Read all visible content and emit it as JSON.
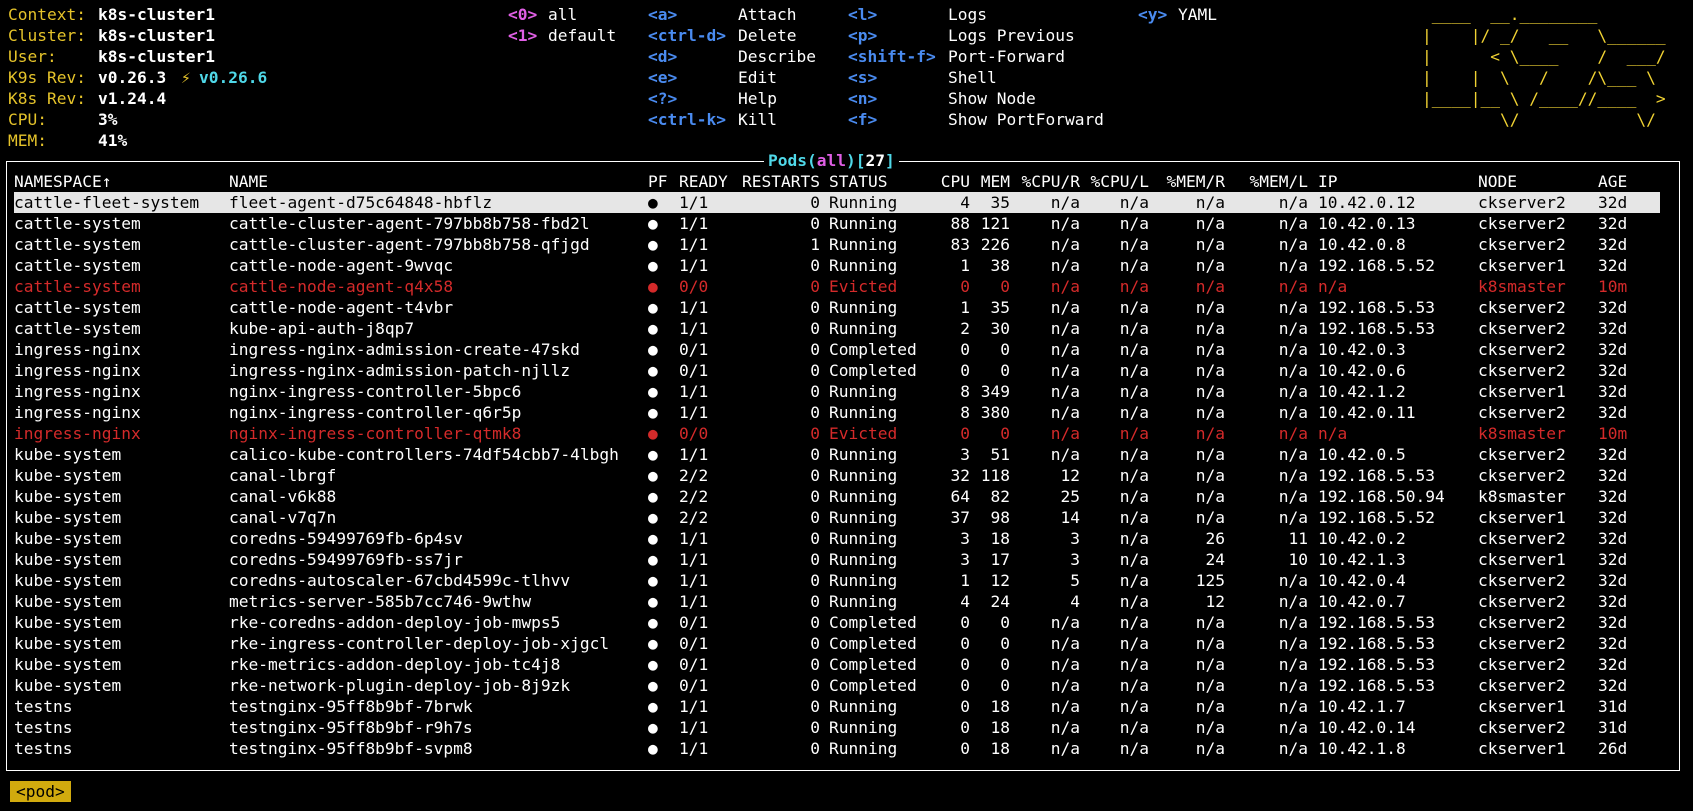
{
  "info": [
    {
      "label": "Context:",
      "value": "k8s-cluster1"
    },
    {
      "label": "Cluster:",
      "value": "k8s-cluster1"
    },
    {
      "label": "User:",
      "value": "k8s-cluster1"
    },
    {
      "label": "K9s Rev:",
      "value": "v0.26.3",
      "extra_sym": "⚡",
      "extra": "v0.26.6"
    },
    {
      "label": "K8s Rev:",
      "value": "v1.24.4"
    },
    {
      "label": "CPU:",
      "value": "3%"
    },
    {
      "label": "MEM:",
      "value": "41%"
    }
  ],
  "namespaces": [
    {
      "key": "<0>",
      "name": "all"
    },
    {
      "key": "<1>",
      "name": "default"
    }
  ],
  "shortcuts_col1": [
    {
      "key": "<a>",
      "desc": "Attach"
    },
    {
      "key": "<ctrl-d>",
      "desc": "Delete"
    },
    {
      "key": "<d>",
      "desc": "Describe"
    },
    {
      "key": "<e>",
      "desc": "Edit"
    },
    {
      "key": "<?>",
      "desc": "Help"
    },
    {
      "key": "<ctrl-k>",
      "desc": "Kill"
    }
  ],
  "shortcuts_col2": [
    {
      "key": "<l>",
      "desc": "Logs"
    },
    {
      "key": "<p>",
      "desc": "Logs Previous"
    },
    {
      "key": "<shift-f>",
      "desc": "Port-Forward"
    },
    {
      "key": "<s>",
      "desc": "Shell"
    },
    {
      "key": "<n>",
      "desc": "Show Node"
    },
    {
      "key": "<f>",
      "desc": "Show PortForward"
    }
  ],
  "shortcuts_col3": [
    {
      "key": "<y>",
      "desc": "YAML"
    }
  ],
  "logo": [
    " ____  __.________        ",
    "|    |/ _/   __   \\______ ",
    "|      < \\____    /  ___/ ",
    "|    |  \\   /    /\\___ \\  ",
    "|____|__ \\ /____//____  > ",
    "        \\/            \\/  "
  ],
  "table": {
    "title_resource": "Pods",
    "title_scope": "all",
    "title_count": "27",
    "columns": [
      "NAMESPACE↑",
      "NAME",
      "PF",
      "READY",
      "RESTARTS",
      "STATUS",
      "CPU",
      "MEM",
      "%CPU/R",
      "%CPU/L",
      "%MEM/R",
      "%MEM/L",
      "IP",
      "NODE",
      "AGE"
    ],
    "rows": [
      [
        "cattle-fleet-system",
        "fleet-agent-d75c64848-hbflz",
        "●",
        "1/1",
        "0",
        "Running",
        "4",
        "35",
        "n/a",
        "n/a",
        "n/a",
        "n/a",
        "10.42.0.12",
        "ckserver2",
        "32d",
        "selected"
      ],
      [
        "cattle-system",
        "cattle-cluster-agent-797bb8b758-fbd2l",
        "●",
        "1/1",
        "0",
        "Running",
        "88",
        "121",
        "n/a",
        "n/a",
        "n/a",
        "n/a",
        "10.42.0.13",
        "ckserver2",
        "32d",
        "normal"
      ],
      [
        "cattle-system",
        "cattle-cluster-agent-797bb8b758-qfjgd",
        "●",
        "1/1",
        "1",
        "Running",
        "83",
        "226",
        "n/a",
        "n/a",
        "n/a",
        "n/a",
        "10.42.0.8",
        "ckserver2",
        "32d",
        "normal"
      ],
      [
        "cattle-system",
        "cattle-node-agent-9wvqc",
        "●",
        "1/1",
        "0",
        "Running",
        "1",
        "38",
        "n/a",
        "n/a",
        "n/a",
        "n/a",
        "192.168.5.52",
        "ckserver1",
        "32d",
        "normal"
      ],
      [
        "cattle-system",
        "cattle-node-agent-q4x58",
        "●",
        "0/0",
        "0",
        "Evicted",
        "0",
        "0",
        "n/a",
        "n/a",
        "n/a",
        "n/a",
        "n/a",
        "k8smaster",
        "10m",
        "error"
      ],
      [
        "cattle-system",
        "cattle-node-agent-t4vbr",
        "●",
        "1/1",
        "0",
        "Running",
        "1",
        "35",
        "n/a",
        "n/a",
        "n/a",
        "n/a",
        "192.168.5.53",
        "ckserver2",
        "32d",
        "normal"
      ],
      [
        "cattle-system",
        "kube-api-auth-j8qp7",
        "●",
        "1/1",
        "0",
        "Running",
        "2",
        "30",
        "n/a",
        "n/a",
        "n/a",
        "n/a",
        "192.168.5.53",
        "ckserver2",
        "32d",
        "normal"
      ],
      [
        "ingress-nginx",
        "ingress-nginx-admission-create-47skd",
        "●",
        "0/1",
        "0",
        "Completed",
        "0",
        "0",
        "n/a",
        "n/a",
        "n/a",
        "n/a",
        "10.42.0.3",
        "ckserver2",
        "32d",
        "normal"
      ],
      [
        "ingress-nginx",
        "ingress-nginx-admission-patch-njllz",
        "●",
        "0/1",
        "0",
        "Completed",
        "0",
        "0",
        "n/a",
        "n/a",
        "n/a",
        "n/a",
        "10.42.0.6",
        "ckserver2",
        "32d",
        "normal"
      ],
      [
        "ingress-nginx",
        "nginx-ingress-controller-5bpc6",
        "●",
        "1/1",
        "0",
        "Running",
        "8",
        "349",
        "n/a",
        "n/a",
        "n/a",
        "n/a",
        "10.42.1.2",
        "ckserver1",
        "32d",
        "normal"
      ],
      [
        "ingress-nginx",
        "nginx-ingress-controller-q6r5p",
        "●",
        "1/1",
        "0",
        "Running",
        "8",
        "380",
        "n/a",
        "n/a",
        "n/a",
        "n/a",
        "10.42.0.11",
        "ckserver2",
        "32d",
        "normal"
      ],
      [
        "ingress-nginx",
        "nginx-ingress-controller-qtmk8",
        "●",
        "0/0",
        "0",
        "Evicted",
        "0",
        "0",
        "n/a",
        "n/a",
        "n/a",
        "n/a",
        "n/a",
        "k8smaster",
        "10m",
        "error"
      ],
      [
        "kube-system",
        "calico-kube-controllers-74df54cbb7-4lbgh",
        "●",
        "1/1",
        "0",
        "Running",
        "3",
        "51",
        "n/a",
        "n/a",
        "n/a",
        "n/a",
        "10.42.0.5",
        "ckserver2",
        "32d",
        "normal"
      ],
      [
        "kube-system",
        "canal-lbrgf",
        "●",
        "2/2",
        "0",
        "Running",
        "32",
        "118",
        "12",
        "n/a",
        "n/a",
        "n/a",
        "192.168.5.53",
        "ckserver2",
        "32d",
        "normal"
      ],
      [
        "kube-system",
        "canal-v6k88",
        "●",
        "2/2",
        "0",
        "Running",
        "64",
        "82",
        "25",
        "n/a",
        "n/a",
        "n/a",
        "192.168.50.94",
        "k8smaster",
        "32d",
        "normal"
      ],
      [
        "kube-system",
        "canal-v7q7n",
        "●",
        "2/2",
        "0",
        "Running",
        "37",
        "98",
        "14",
        "n/a",
        "n/a",
        "n/a",
        "192.168.5.52",
        "ckserver1",
        "32d",
        "normal"
      ],
      [
        "kube-system",
        "coredns-59499769fb-6p4sv",
        "●",
        "1/1",
        "0",
        "Running",
        "3",
        "18",
        "3",
        "n/a",
        "26",
        "11",
        "10.42.0.2",
        "ckserver2",
        "32d",
        "normal"
      ],
      [
        "kube-system",
        "coredns-59499769fb-ss7jr",
        "●",
        "1/1",
        "0",
        "Running",
        "3",
        "17",
        "3",
        "n/a",
        "24",
        "10",
        "10.42.1.3",
        "ckserver1",
        "32d",
        "normal"
      ],
      [
        "kube-system",
        "coredns-autoscaler-67cbd4599c-tlhvv",
        "●",
        "1/1",
        "0",
        "Running",
        "1",
        "12",
        "5",
        "n/a",
        "125",
        "n/a",
        "10.42.0.4",
        "ckserver2",
        "32d",
        "normal"
      ],
      [
        "kube-system",
        "metrics-server-585b7cc746-9wthw",
        "●",
        "1/1",
        "0",
        "Running",
        "4",
        "24",
        "4",
        "n/a",
        "12",
        "n/a",
        "10.42.0.7",
        "ckserver2",
        "32d",
        "normal"
      ],
      [
        "kube-system",
        "rke-coredns-addon-deploy-job-mwps5",
        "●",
        "0/1",
        "0",
        "Completed",
        "0",
        "0",
        "n/a",
        "n/a",
        "n/a",
        "n/a",
        "192.168.5.53",
        "ckserver2",
        "32d",
        "normal"
      ],
      [
        "kube-system",
        "rke-ingress-controller-deploy-job-xjgcl",
        "●",
        "0/1",
        "0",
        "Completed",
        "0",
        "0",
        "n/a",
        "n/a",
        "n/a",
        "n/a",
        "192.168.5.53",
        "ckserver2",
        "32d",
        "normal"
      ],
      [
        "kube-system",
        "rke-metrics-addon-deploy-job-tc4j8",
        "●",
        "0/1",
        "0",
        "Completed",
        "0",
        "0",
        "n/a",
        "n/a",
        "n/a",
        "n/a",
        "192.168.5.53",
        "ckserver2",
        "32d",
        "normal"
      ],
      [
        "kube-system",
        "rke-network-plugin-deploy-job-8j9zk",
        "●",
        "0/1",
        "0",
        "Completed",
        "0",
        "0",
        "n/a",
        "n/a",
        "n/a",
        "n/a",
        "192.168.5.53",
        "ckserver2",
        "32d",
        "normal"
      ],
      [
        "testns",
        "testnginx-95ff8b9bf-7brwk",
        "●",
        "1/1",
        "0",
        "Running",
        "0",
        "18",
        "n/a",
        "n/a",
        "n/a",
        "n/a",
        "10.42.1.7",
        "ckserver1",
        "31d",
        "normal"
      ],
      [
        "testns",
        "testnginx-95ff8b9bf-r9h7s",
        "●",
        "1/1",
        "0",
        "Running",
        "0",
        "18",
        "n/a",
        "n/a",
        "n/a",
        "n/a",
        "10.42.0.14",
        "ckserver2",
        "31d",
        "normal"
      ],
      [
        "testns",
        "testnginx-95ff8b9bf-svpm8",
        "●",
        "1/1",
        "0",
        "Running",
        "0",
        "18",
        "n/a",
        "n/a",
        "n/a",
        "n/a",
        "10.42.1.8",
        "ckserver1",
        "26d",
        "normal"
      ]
    ]
  },
  "crumb": "<pod>",
  "colors": {
    "label": "#e5c32a",
    "cyan": "#4fd8e8",
    "key": "#4a8bf0",
    "magenta": "#e05fe5",
    "error": "#d42a2a",
    "selected_bg": "#e6e6e6",
    "crumb_bg": "#d1aa0e"
  }
}
